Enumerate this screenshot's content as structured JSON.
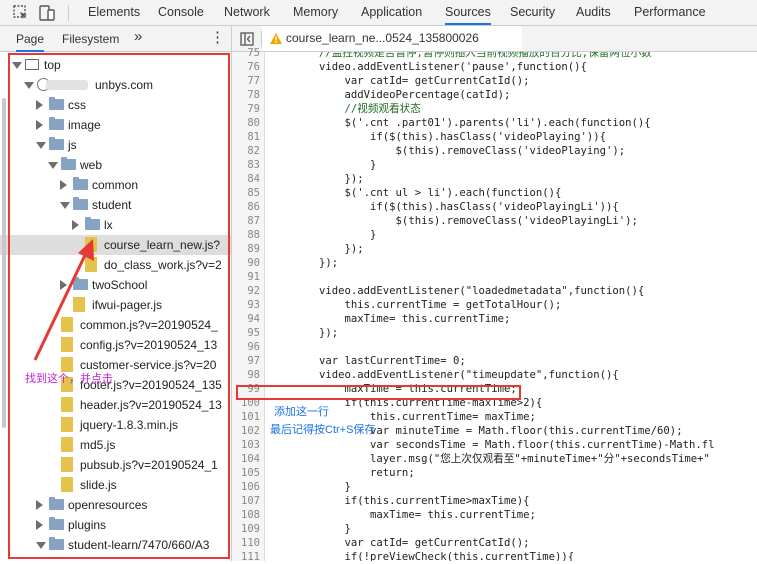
{
  "devtools": {
    "tabs": [
      "Elements",
      "Console",
      "Network",
      "Memory",
      "Application",
      "Sources",
      "Security",
      "Audits",
      "Performance"
    ],
    "active_tab": "Sources"
  },
  "navigator": {
    "tabs": [
      "Page",
      "Filesystem"
    ],
    "more": "»",
    "tree": [
      {
        "label": "top",
        "icon": "frame",
        "arrow": "down",
        "depth": 0
      },
      {
        "label": "unbys.com",
        "icon": "globe",
        "arrow": "down",
        "depth": 1,
        "blurred": true
      },
      {
        "label": "css",
        "icon": "folder",
        "arrow": "right",
        "depth": 2
      },
      {
        "label": "image",
        "icon": "folder",
        "arrow": "right",
        "depth": 2
      },
      {
        "label": "js",
        "icon": "folder",
        "arrow": "down",
        "depth": 2
      },
      {
        "label": "web",
        "icon": "folder",
        "arrow": "down",
        "depth": 3
      },
      {
        "label": "common",
        "icon": "folder",
        "arrow": "right",
        "depth": 4
      },
      {
        "label": "student",
        "icon": "folder",
        "arrow": "down",
        "depth": 4
      },
      {
        "label": "lx",
        "icon": "folder",
        "arrow": "right",
        "depth": 5
      },
      {
        "label": "course_learn_new.js?",
        "icon": "file",
        "arrow": "",
        "depth": 5,
        "selected": true
      },
      {
        "label": "do_class_work.js?v=2",
        "icon": "file",
        "arrow": "",
        "depth": 5
      },
      {
        "label": "twoSchool",
        "icon": "folder",
        "arrow": "right",
        "depth": 4
      },
      {
        "label": "ifwui-pager.js",
        "icon": "file",
        "arrow": "",
        "depth": 4
      },
      {
        "label": "common.js?v=20190524_",
        "icon": "file",
        "arrow": "",
        "depth": 3
      },
      {
        "label": "config.js?v=20190524_13",
        "icon": "file",
        "arrow": "",
        "depth": 3
      },
      {
        "label": "customer-service.js?v=20",
        "icon": "file",
        "arrow": "",
        "depth": 3
      },
      {
        "label": "footer.js?v=20190524_135",
        "icon": "file",
        "arrow": "",
        "depth": 3
      },
      {
        "label": "header.js?v=20190524_13",
        "icon": "file",
        "arrow": "",
        "depth": 3
      },
      {
        "label": "jquery-1.8.3.min.js",
        "icon": "file",
        "arrow": "",
        "depth": 3
      },
      {
        "label": "md5.js",
        "icon": "file",
        "arrow": "",
        "depth": 3
      },
      {
        "label": "pubsub.js?v=20190524_1",
        "icon": "file",
        "arrow": "",
        "depth": 3
      },
      {
        "label": "slide.js",
        "icon": "file",
        "arrow": "",
        "depth": 3
      },
      {
        "label": "openresources",
        "icon": "folder",
        "arrow": "right",
        "depth": 2
      },
      {
        "label": "plugins",
        "icon": "folder",
        "arrow": "right",
        "depth": 2
      },
      {
        "label": "student-learn/7470/660/A3",
        "icon": "folder",
        "arrow": "down",
        "depth": 2
      }
    ]
  },
  "editor": {
    "open_file": "course_learn_ne...0524_135800026",
    "warning_icon": "warning-icon",
    "first_line": 75,
    "lines": [
      "        //监控视频是否暂停,暂停则插入当前视频播放的百分比,保留两位小数",
      "        video.addEventListener('pause',function(){",
      "            var catId= getCurrentCatId();",
      "            addVideoPercentage(catId);",
      "            //视频观看状态",
      "            $('.cnt .part01').parents('li').each(function(){",
      "                if($(this).hasClass('videoPlaying')){",
      "                    $(this).removeClass('videoPlaying');",
      "                }",
      "            });",
      "            $('.cnt ul > li').each(function(){",
      "                if($(this).hasClass('videoPlayingLi')){",
      "                    $(this).removeClass('videoPlayingLi');",
      "                }",
      "            });",
      "        });",
      "",
      "        video.addEventListener(\"loadedmetadata\",function(){",
      "            this.currentTime = getTotalHour();",
      "            maxTime= this.currentTime;",
      "        });",
      "",
      "        var lastCurrentTime= 0;",
      "        video.addEventListener(\"timeupdate\",function(){",
      "            maxTime = this.currentTime;",
      "            if(this.currentTime-maxTime>2){",
      "                this.currentTime= maxTime;",
      "                var minuteTime = Math.floor(this.currentTime/60);",
      "                var secondsTime = Math.floor(this.currentTime)-Math.fl",
      "                layer.msg(\"您上次仅观看至\"+minuteTime+\"分\"+secondsTime+\"",
      "                return;",
      "            }",
      "            if(this.currentTime>maxTime){",
      "                maxTime= this.currentTime;",
      "            }",
      "            var catId= getCurrentCatId();",
      "            if(!preViewCheck(this.currentTime)){"
    ]
  },
  "annotations": {
    "click_hint": "找到这个，并点击",
    "add_line": "添加这一行",
    "save_hint": "最后记得按Ctr+S保存",
    "color": "#e53935",
    "hint_color": "#c026d3",
    "blue_color": "#1a73e8"
  }
}
